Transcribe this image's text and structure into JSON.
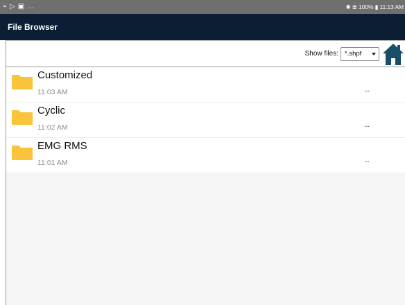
{
  "status_bar": {
    "right_text": "✱ ≣ 100% ▮ 11:13 AM",
    "left_icons": [
      "link-icon",
      "play-icon",
      "image-icon",
      "more-dots-icon"
    ]
  },
  "app_bar": {
    "title": "File Browser"
  },
  "toolbar": {
    "show_files_label": "Show files:",
    "filter_value": "*.shpf"
  },
  "files": [
    {
      "name": "Customized",
      "time": "11:03 AM",
      "more": "..."
    },
    {
      "name": "Cyclic",
      "time": "11:02 AM",
      "more": "..."
    },
    {
      "name": "EMG RMS",
      "time": "11:01 AM",
      "more": "..."
    }
  ],
  "colors": {
    "status_bar": "#6f6f6f",
    "app_bar": "#0b1e33",
    "folder": "#f9c33a",
    "home_icon": "#1a4d66"
  }
}
